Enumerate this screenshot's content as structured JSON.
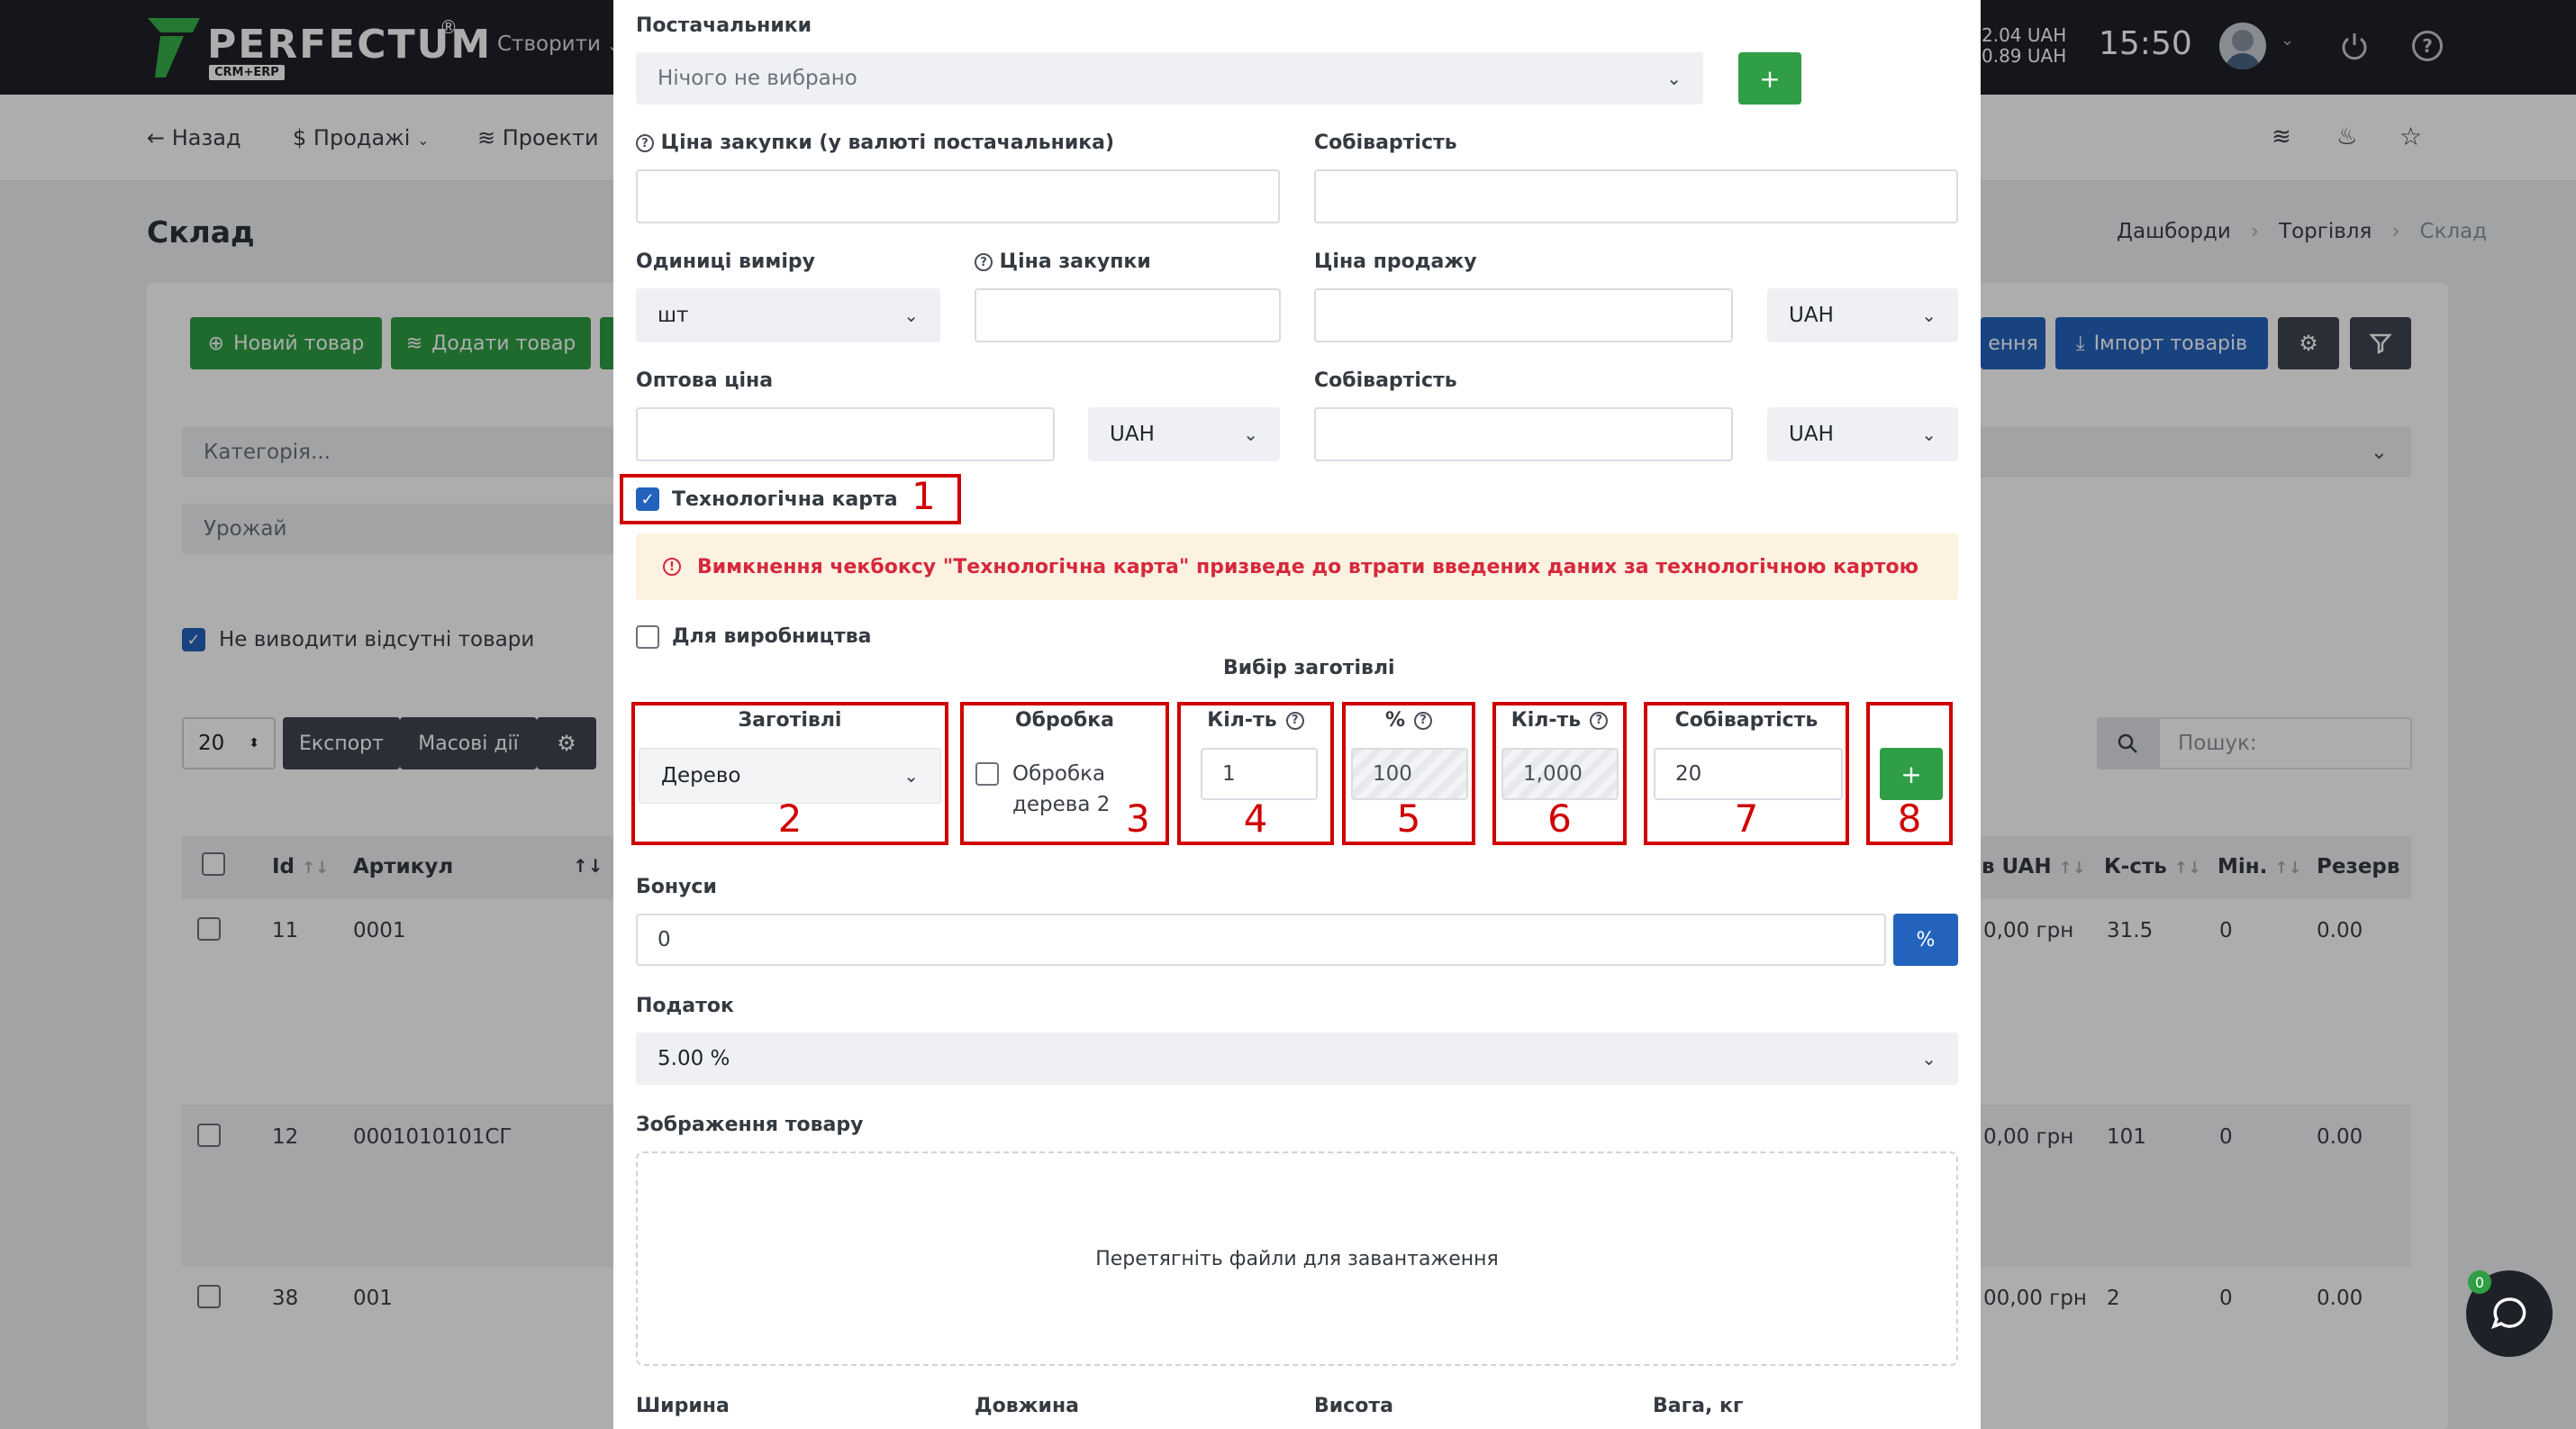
{
  "header": {
    "logo_text": "PERFECTUM",
    "logo_reg": "®",
    "logo_sub": "CRM+ERP",
    "create_label": "Створити",
    "rate1": "2.04 UAH",
    "rate2": "0.89 UAH",
    "clock": "15:50"
  },
  "subnav": {
    "back": "Назад",
    "sales": "Продажі",
    "projects": "Проекти"
  },
  "page": {
    "title": "Склад",
    "breadcrumb": [
      "Дашборди",
      "Торгівля",
      "Склад"
    ]
  },
  "toolbar": {
    "new_product": "Новий товар",
    "add_product": "Додати товар",
    "renew_partial": "ення",
    "import_products": "Імпорт товарів"
  },
  "filters": {
    "category_placeholder": "Категорія...",
    "harvest": "Урожай",
    "hide_missing": "Не виводити відсутні товари"
  },
  "table_controls": {
    "page_size": "20",
    "export": "Експорт",
    "bulk": "Масові дії",
    "search_placeholder": "Пошук:"
  },
  "table": {
    "headers": {
      "id": "Id",
      "article": "Артикул",
      "price_uah": "в UAH",
      "qty": "К-сть",
      "min": "Мін.",
      "reserve": "Резерв"
    },
    "rows": [
      {
        "id": "11",
        "article": "0001",
        "price": "0,00 грн",
        "qty": "31.5",
        "min": "0",
        "reserve": "0.00"
      },
      {
        "id": "12",
        "article": "0001010101СГ",
        "price": "0,00 грн",
        "qty": "101",
        "min": "0",
        "reserve": "0.00"
      },
      {
        "id": "38",
        "article": "001",
        "price": "00,00 грн",
        "qty": "2",
        "min": "0",
        "reserve": "0.00"
      }
    ]
  },
  "chat": {
    "badge": "0"
  },
  "modal": {
    "suppliers_label": "Постачальники",
    "suppliers_value": "Нічого не вибрано",
    "purchase_price_supplier_label": "Ціна закупки (у валюті постачальника)",
    "cost_label": "Собівартість",
    "units_label": "Одиниці виміру",
    "units_value": "шт",
    "purchase_price_label": "Ціна закупки",
    "sale_price_label": "Ціна продажу",
    "currency1": "UAH",
    "wholesale_label": "Оптова ціна",
    "currency2": "UAH",
    "cost2_label": "Собівартість",
    "currency3": "UAH",
    "tech_card_label": "Технологічна карта",
    "warning": "Вимкнення чекбоксу \"Технологічна карта\" призведе до втрати введених даних за технологічною картою",
    "production_label": "Для виробництва",
    "blank_choice_title": "Вибір заготівлі",
    "blanks": {
      "col_blanks": "Заготівлі",
      "blank_value": "Дерево",
      "col_processing": "Обробка",
      "processing_value_line1": "Обробка",
      "processing_value_line2": "дерева 2",
      "col_qty": "Кіл-ть",
      "qty_value": "1",
      "col_pct": "%",
      "pct_value": "100",
      "col_qty2": "Кіл-ть",
      "qty2_value": "1,000",
      "col_cost": "Собівартість",
      "cost_value": "20",
      "add": "+"
    },
    "bonus_label": "Бонуси",
    "bonus_value": "0",
    "bonus_btn": "%",
    "tax_label": "Податок",
    "tax_value": "5.00 %",
    "image_label": "Зображення товару",
    "dropzone": "Перетягніть файли для завантаження",
    "width_label": "Ширина",
    "length_label": "Довжина",
    "height_label": "Висота",
    "weight_label": "Вага, кг",
    "supplier_add": "+"
  },
  "annotations": [
    "1",
    "2",
    "3",
    "4",
    "5",
    "6",
    "7",
    "8"
  ],
  "colors": {
    "accent_green": "#2f9e44",
    "accent_blue": "#2463bd",
    "annotation_red": "#d00000",
    "warning_bg": "#fdf2e1",
    "warning_text": "#d6283c"
  }
}
